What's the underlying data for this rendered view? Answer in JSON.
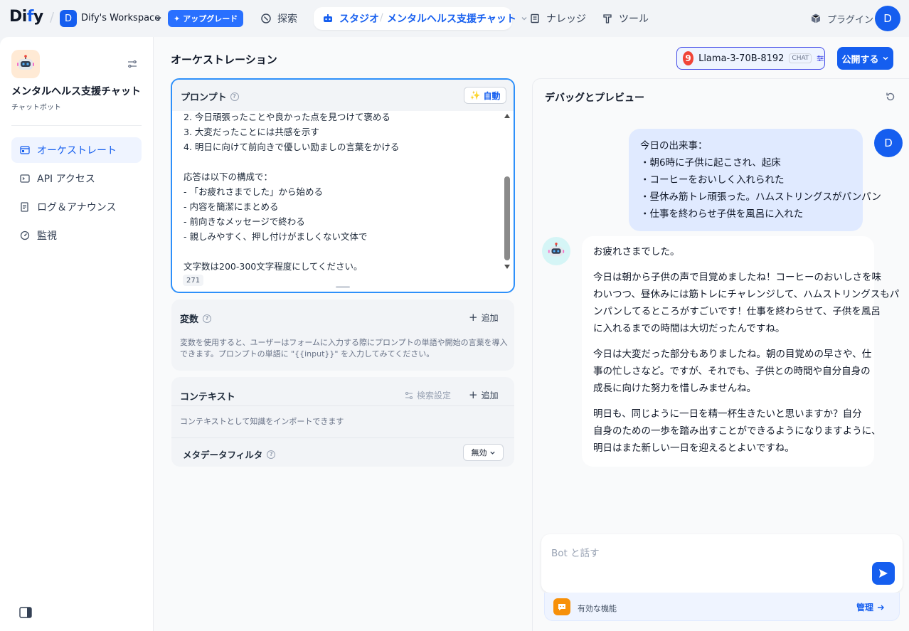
{
  "topbar": {
    "logo_main": "Di",
    "logo_dot": "f",
    "logo_end": "y",
    "workspace_initial": "D",
    "workspace_name": "Dify's Workspace",
    "upgrade_label": "アップグレード",
    "nav": {
      "explore": "探索",
      "studio": "スタジオ",
      "app_name": "メンタルヘルス支援チャット",
      "knowledge": "ナレッジ",
      "tools": "ツール",
      "plugins": "プラグイン"
    },
    "user_initial": "D"
  },
  "sidebar": {
    "app_title": "メンタルヘルス支援チャット",
    "app_type": "チャットボット",
    "items": [
      {
        "label": "オーケストレート",
        "icon": "window-icon"
      },
      {
        "label": "API アクセス",
        "icon": "terminal-icon"
      },
      {
        "label": "ログ＆アナウンス",
        "icon": "document-icon"
      },
      {
        "label": "監視",
        "icon": "gauge-icon"
      }
    ]
  },
  "main": {
    "title": "オーケストレーション",
    "model": {
      "badge": "9",
      "name": "Llama-3-70B-8192",
      "tag": "CHAT"
    },
    "publish_label": "公開する",
    "prompt": {
      "label": "プロンプト",
      "auto_label": "自動",
      "lines": [
        "2. 今日頑張ったことや良かった点を見つけて褒める",
        "3. 大変だったことには共感を示す",
        "4. 明日に向けて前向きで優しい励ましの言葉をかける",
        "",
        "応答は以下の構成で：",
        "- 「お疲れさまでした」から始める",
        "- 内容を簡潔にまとめる",
        "- 前向きなメッセージで終わる",
        "- 親しみやすく、押し付けがましくない文体で",
        "",
        "文字数は200-300文字程度にしてください。"
      ],
      "char_count": "271"
    },
    "variables": {
      "title": "変数",
      "add_label": "追加",
      "description": "変数を使用すると、ユーザーはフォームに入力する際にプロンプトの単語や開始の言葉を導入できます。プロンプトの単語に \"{{input}}\" を入力してみてください。"
    },
    "context": {
      "title": "コンテキスト",
      "retrieval_label": "検索設定",
      "add_label": "追加",
      "description": "コンテキストとして知識をインポートできます",
      "metadata_title": "メタデータフィルタ",
      "metadata_value": "無効"
    }
  },
  "debug": {
    "title": "デバッグとプレビュー",
    "user_initial": "D",
    "user_message": [
      "今日の出来事：",
      "・朝6時に子供に起こされ、起床",
      "・コーヒーをおいしく入れられた",
      "・昼休み筋トレ頑張った。ハムストリングスがパンパン",
      "・仕事を終わらせ子供を風呂に入れた"
    ],
    "bot_message": [
      [
        "お疲れさまでした。"
      ],
      [
        "今日は朝から子供の声で目覚めましたね！コーヒーのおいしさを味",
        "わいつつ、昼休みには筋トレにチャレンジして、ハムストリングスもパ",
        "ンパンしてるところがすごいです！仕事を終わらせて、子供を風呂",
        "に入れるまでの時間は大切だったんですね。"
      ],
      [
        "今日は大変だった部分もありましたね。朝の目覚めの早さや、仕",
        "事の忙しさなど。ですが、それでも、子供との時間や自分自身の",
        "成長に向けた努力を惜しみませんね。"
      ],
      [
        "明日も、同じように一日を精一杯生きたいと思いますか？自分",
        "自身のための一歩を踏み出すことができるようになりますように、",
        "明日はまた新しい一日を迎えるとよいですね。"
      ]
    ],
    "input_placeholder": "Bot と話す",
    "features_label": "有効な機能",
    "manage_label": "管理"
  },
  "colors": {
    "primary": "#155eef",
    "accent_border": "#2e90fa",
    "user_bubble": "#e0eaff"
  }
}
